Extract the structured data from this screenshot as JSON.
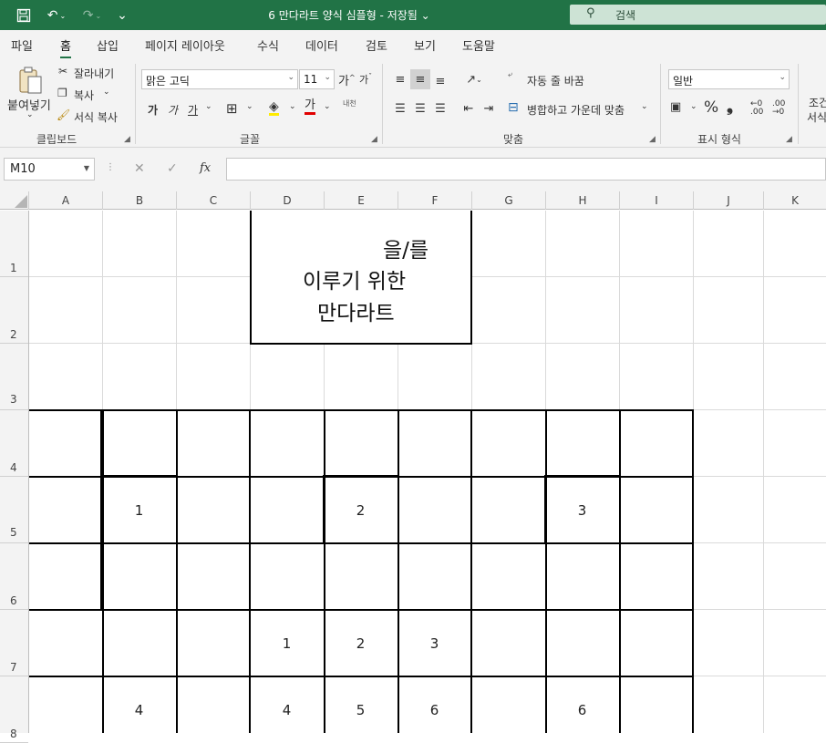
{
  "titlebar": {
    "document_title": "6 만다라트 양식 심플형 - 저장됨 ⌄",
    "search_label": "검색"
  },
  "menu": {
    "tabs": [
      "파일",
      "홈",
      "삽입",
      "페이지 레이아웃",
      "수식",
      "데이터",
      "검토",
      "보기",
      "도움말"
    ],
    "active_tab": "홈"
  },
  "ribbon": {
    "clipboard": {
      "paste_label": "붙여넣기",
      "cut_label": "잘라내기",
      "copy_label": "복사",
      "format_painter_label": "서식 복사",
      "group_label": "클립보드"
    },
    "font": {
      "font_name": "맑은 고딕",
      "font_size": "11",
      "bold": "가",
      "italic": "가",
      "underline": "가",
      "grow": "가",
      "shrink": "가",
      "font_color_letter": "가",
      "phonetic": "내천",
      "group_label": "글꼴"
    },
    "alignment": {
      "wrap_text_label": "자동 줄 바꿈",
      "merge_center_label": "병합하고 가운데 맞춤",
      "group_label": "맞춤"
    },
    "number": {
      "format": "일반",
      "percent": "%",
      "comma": "❟",
      "group_label": "표시 형식"
    },
    "conditional": {
      "line1": "조건",
      "line2": "서식"
    }
  },
  "formula_bar": {
    "name_box": "M10",
    "fx_label": "fx",
    "cancel": "✕",
    "enter": "✓",
    "content": ""
  },
  "sheet": {
    "columns": [
      "A",
      "B",
      "C",
      "D",
      "E",
      "F",
      "G",
      "H",
      "I",
      "J",
      "K"
    ],
    "rows": [
      "1",
      "2",
      "3",
      "4",
      "5",
      "6",
      "7",
      "8"
    ],
    "title_lines": [
      "을/를",
      "이루기 위한",
      "만다라트"
    ],
    "cells": {
      "B5": "1",
      "E5": "2",
      "H5": "3",
      "D7": "1",
      "E7": "2",
      "F7": "3",
      "B8": "4",
      "D8": "4",
      "E8": "5",
      "F8": "6",
      "H8": "6"
    }
  },
  "colors": {
    "brand_green": "#217346",
    "ribbon_bg": "#f3f3f3",
    "grid_line": "#dadada",
    "border": "#000000"
  }
}
